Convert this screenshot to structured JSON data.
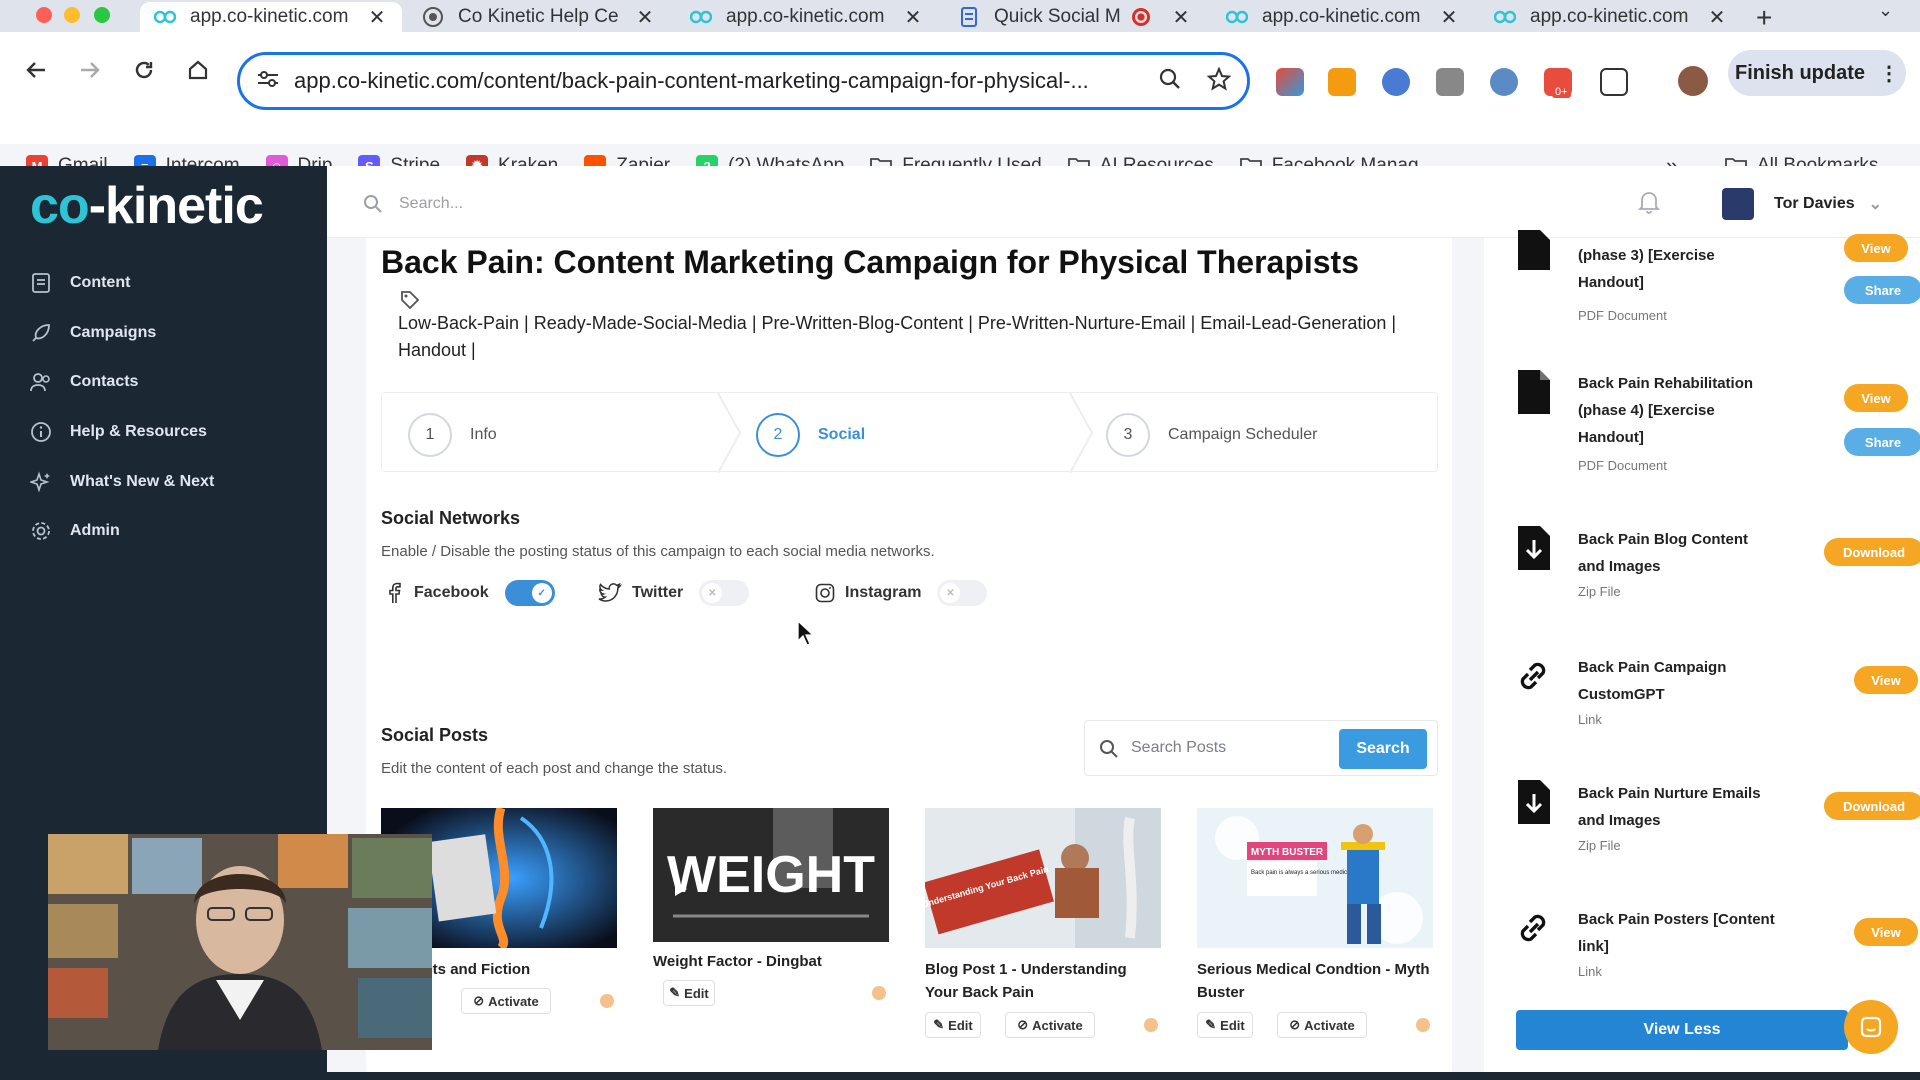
{
  "browser": {
    "tabs": [
      {
        "title": "app.co-kinetic.com",
        "active": true
      },
      {
        "title": "Co Kinetic Help Ce",
        "active": false
      },
      {
        "title": "app.co-kinetic.com",
        "active": false
      },
      {
        "title": "Quick Social M",
        "active": false
      },
      {
        "title": "app.co-kinetic.com",
        "active": false
      },
      {
        "title": "app.co-kinetic.com",
        "active": false
      }
    ],
    "url": "app.co-kinetic.com/content/back-pain-content-marketing-campaign-for-physical-...",
    "finish_update": "Finish update",
    "extension_badge": "0+",
    "bookmarks": [
      {
        "label": "Gmail",
        "color": "#ea4335",
        "glyph": "M"
      },
      {
        "label": "Intercom",
        "color": "#1f6feb",
        "glyph": "≡"
      },
      {
        "label": "Drip",
        "color": "#e25ad8",
        "glyph": "☺"
      },
      {
        "label": "Stripe",
        "color": "#635bff",
        "glyph": "S"
      },
      {
        "label": "Kraken",
        "color": "#c0392b",
        "glyph": "✹"
      },
      {
        "label": "Zapier",
        "color": "#ff4f00",
        "glyph": " "
      },
      {
        "label": "(2) WhatsApp",
        "color": "#25d366",
        "glyph": "2"
      },
      {
        "label": "Frequently Used",
        "folder": true
      },
      {
        "label": "AI Resources",
        "folder": true
      },
      {
        "label": "Facebook Manag...",
        "folder": true
      }
    ],
    "all_bookmarks": "All Bookmarks"
  },
  "sidebar": {
    "logo_co": "co",
    "logo_rest": "-kinetic",
    "items": [
      {
        "label": "Content",
        "icon": "document-icon"
      },
      {
        "label": "Campaigns",
        "icon": "rocket-icon"
      },
      {
        "label": "Contacts",
        "icon": "users-icon"
      },
      {
        "label": "Help & Resources",
        "icon": "info-icon"
      },
      {
        "label": "What's New & Next",
        "icon": "sparkle-icon"
      },
      {
        "label": "Admin",
        "icon": "gear-icon"
      }
    ]
  },
  "topbar": {
    "search_placeholder": "Search...",
    "user_name": "Tor Davies"
  },
  "page": {
    "title": "Back Pain: Content Marketing Campaign for Physical Therapists",
    "tags": "Low-Back-Pain | Ready-Made-Social-Media | Pre-Written-Blog-Content | Pre-Written-Nurture-Email | Email-Lead-Generation | Handout |",
    "steps": [
      {
        "num": "1",
        "label": "Info",
        "active": false
      },
      {
        "num": "2",
        "label": "Social",
        "active": true
      },
      {
        "num": "3",
        "label": "Campaign Scheduler",
        "active": false
      }
    ],
    "social_networks": {
      "title": "Social Networks",
      "desc": "Enable / Disable the posting status of this campaign to each social media networks.",
      "networks": [
        {
          "label": "Facebook",
          "enabled": true
        },
        {
          "label": "Twitter",
          "enabled": false
        },
        {
          "label": "Instagram",
          "enabled": false
        }
      ]
    },
    "social_posts": {
      "title": "Social Posts",
      "desc": "Edit the content of each post and change the status.",
      "search_placeholder": "Search Posts",
      "search_button": "Search",
      "posts": [
        {
          "title": "ain Facts and Fiction",
          "edit": "t",
          "activate": "Activate"
        },
        {
          "title": "Weight Factor - Dingbat",
          "edit": "Edit",
          "activate": ""
        },
        {
          "title": "Blog Post 1 - Understanding Your Back Pain",
          "edit": "Edit",
          "activate": "Activate"
        },
        {
          "title": "Serious Medical Condtion - Myth Buster",
          "edit": "Edit",
          "activate": "Activate"
        }
      ],
      "image_texts": {
        "weight": "WEIGHT",
        "understanding": "Understanding Your Back Pain",
        "myth": "MYTH BUSTER",
        "myth_body": "Back pain is always a serious medical condition"
      }
    }
  },
  "resources": {
    "items": [
      {
        "title": "(phase 3) [Exercise Handout]",
        "subtitle": "PDF Document",
        "buttons": [
          "View",
          "Share"
        ],
        "icon": "file-icon"
      },
      {
        "title": "Back Pain Rehabilitation (phase 4) [Exercise Handout]",
        "subtitle": "PDF Document",
        "buttons": [
          "View",
          "Share"
        ],
        "icon": "file-icon"
      },
      {
        "title": "Back Pain Blog Content and Images",
        "subtitle": "Zip File",
        "buttons": [
          "Download"
        ],
        "icon": "download-file-icon"
      },
      {
        "title": "Back Pain Campaign CustomGPT",
        "subtitle": "Link",
        "buttons": [
          "View"
        ],
        "icon": "link-icon"
      },
      {
        "title": "Back Pain Nurture Emails and Images",
        "subtitle": "Zip File",
        "buttons": [
          "Download"
        ],
        "icon": "download-file-icon"
      },
      {
        "title": "Back Pain Posters [Content link]",
        "subtitle": "Link",
        "buttons": [
          "View"
        ],
        "icon": "link-icon"
      }
    ],
    "view_less": "View Less"
  },
  "colors": {
    "sidebar": "#1b2833",
    "accent": "#3a8fd8",
    "orange": "#f5a623",
    "brand": "#2ec4d6"
  }
}
